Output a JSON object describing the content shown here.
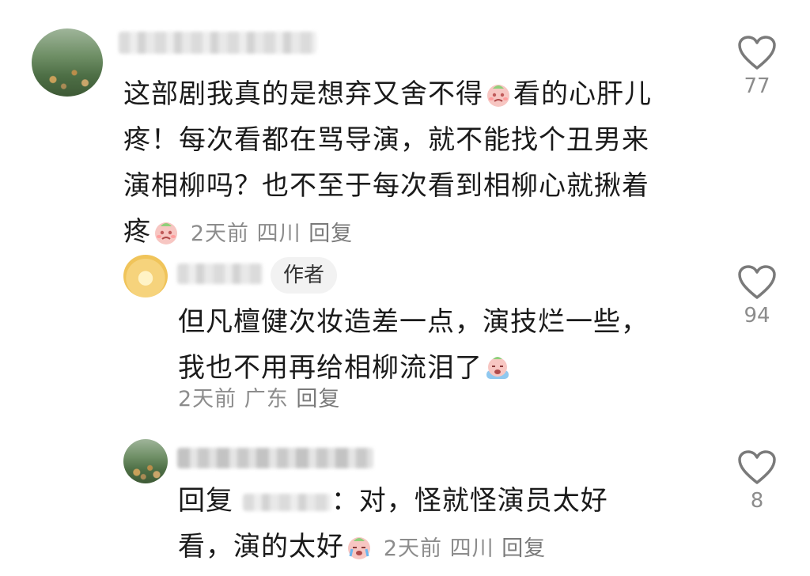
{
  "comments": [
    {
      "text_lines": [
        "这部剧我真的是想弃又舍不得",
        "疼！每次看都在骂导演，就不能找个丑男来",
        "演相柳吗？也不至于每次看到相柳心就揪着",
        "疼"
      ],
      "text_line1_suffix": "看的心肝儿",
      "time": "2天前",
      "location": "四川",
      "reply_label": "回复",
      "likes": "77"
    },
    {
      "author_badge": "作者",
      "text_lines": [
        "但凡檀健次妆造差一点，演技烂一些，",
        "我也不用再给相柳流泪了"
      ],
      "time": "2天前",
      "location": "广东",
      "reply_label": "回复",
      "likes": "94"
    },
    {
      "reply_prefix": "回复",
      "text_line1_suffix": "：对，怪就怪演员太好",
      "text_line2": "看，演的太好",
      "time": "2天前",
      "location": "四川",
      "reply_label": "回复",
      "likes": "8"
    }
  ],
  "icons": {
    "like": "heart-outline-icon",
    "emoji_sad": "crying-peach-emoji",
    "emoji_cry": "sobbing-peach-emoji"
  },
  "colors": {
    "text": "#1a1a1a",
    "meta": "#8c8c8c",
    "badge_bg": "#f2f2f2"
  }
}
